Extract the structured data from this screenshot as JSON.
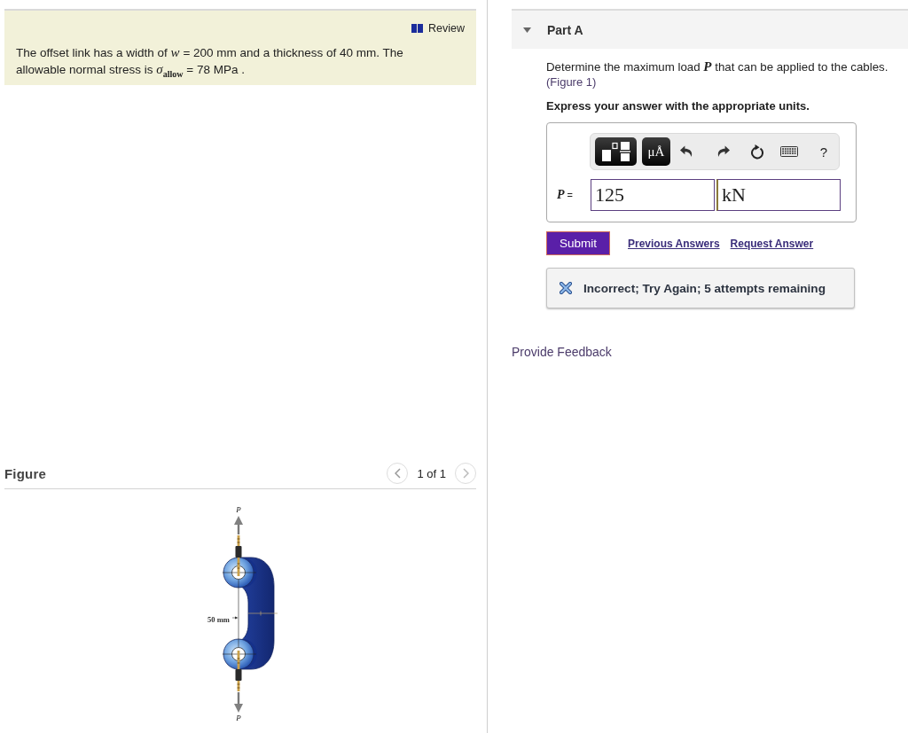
{
  "problem": {
    "review_link": "Review",
    "text": "The offset link has a width of *w* = 200 mm and a thickness of 40 mm. The allowable normal stress is *σ*$_{allow}$ = 78 MPa ."
  },
  "figure": {
    "heading": "Figure",
    "pager": "1 of 1",
    "top_load_label": "P",
    "dimension_label": "50 mm",
    "bottom_load_label": "P"
  },
  "part": {
    "title": "Part A",
    "expanded": true,
    "question": "Determine the maximum load *P* that can be applied to the cables.",
    "figure_link": "(Figure 1)",
    "instruction": "Express your answer with the appropriate units.",
    "toolbar": [
      {
        "kind": "templates"
      },
      {
        "kind": "units",
        "label": "μÅ"
      },
      {
        "kind": "undo"
      },
      {
        "kind": "redo"
      },
      {
        "kind": "reset"
      },
      {
        "kind": "keyboard"
      },
      {
        "kind": "help",
        "label": "?"
      }
    ],
    "answer": {
      "label": "*P* =",
      "value": "125",
      "units": "kN"
    },
    "submit": "Submit",
    "links": [
      "Previous Answers",
      "Request Answer"
    ],
    "feedback": {
      "kind": "incorrect",
      "message": "Incorrect; Try Again; 5 attempts remaining"
    }
  },
  "provide_feedback": "Provide Feedback"
}
